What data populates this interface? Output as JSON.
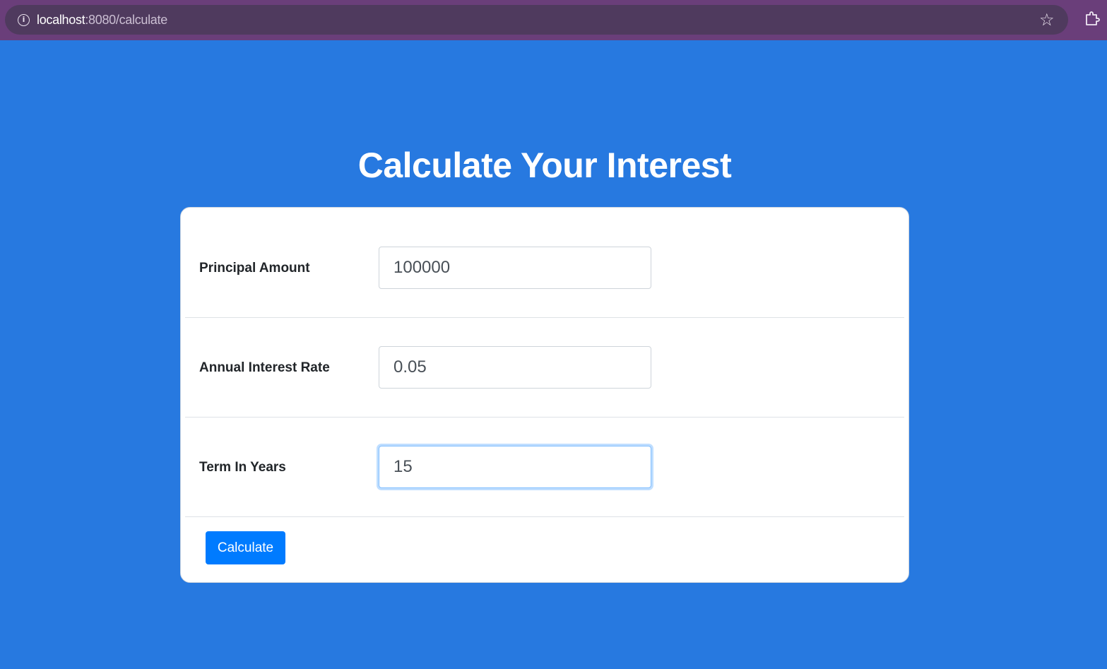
{
  "browser": {
    "url_host": "localhost",
    "url_path": ":8080/calculate",
    "icons": {
      "info": "info-icon",
      "star": "star-icon",
      "extensions": "puzzle-icon"
    }
  },
  "page": {
    "title": "Calculate Your Interest",
    "background_color": "#2779e0"
  },
  "form": {
    "fields": [
      {
        "label": "Principal Amount",
        "value": "100000"
      },
      {
        "label": "Annual Interest Rate",
        "value": "0.05"
      },
      {
        "label": "Term In Years",
        "value": "15",
        "focused": true
      }
    ],
    "submit_label": "Calculate",
    "accent_color": "#007bff"
  }
}
